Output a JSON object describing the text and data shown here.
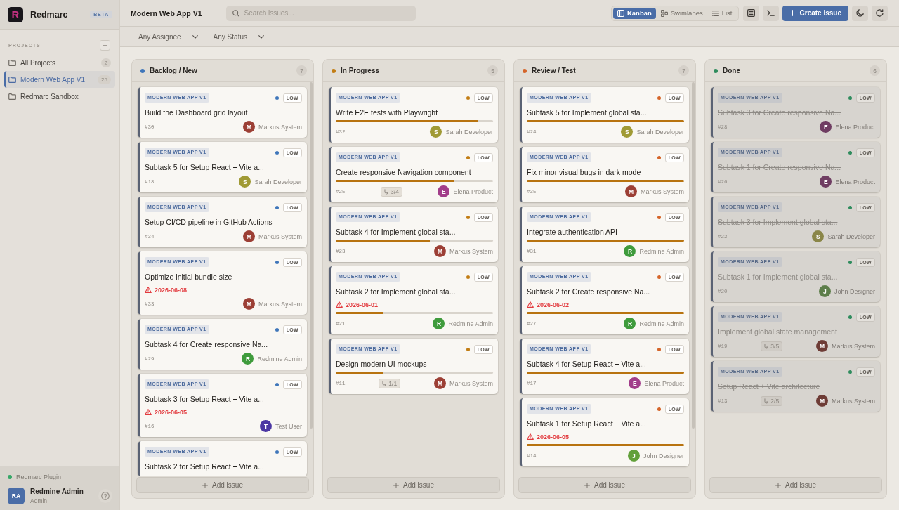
{
  "sidebar": {
    "brand": {
      "logo": "R",
      "name": "Redmarc",
      "badge": "BETA"
    },
    "section_label": "PROJECTS",
    "projects": [
      {
        "label": "All Projects",
        "count": "2",
        "selected": false
      },
      {
        "label": "Modern Web App V1",
        "count": "25",
        "selected": true
      },
      {
        "label": "Redmarc Sandbox",
        "selected": false
      }
    ],
    "plugin": {
      "label": "Redmarc Plugin",
      "active": true
    },
    "user": {
      "initials": "RA",
      "name": "Redmine Admin",
      "role": "Admin"
    }
  },
  "topbar": {
    "title": "Modern Web App V1",
    "search": {
      "placeholder": "Search issues..."
    },
    "views": [
      {
        "kind": "kanban",
        "label": "Kanban",
        "selected": true
      },
      {
        "kind": "swimlanes",
        "label": "Swimlanes",
        "selected": false
      },
      {
        "kind": "list",
        "label": "List",
        "selected": false
      }
    ],
    "create_button": "Create issue"
  },
  "filters": [
    {
      "value": "Any Assignee"
    },
    {
      "value": "Any Status"
    }
  ],
  "columns": [
    {
      "title": "Backlog / New",
      "count": "7",
      "color": "#3f76ba",
      "scrollable": true,
      "add_label": "Add issue",
      "cards": [
        {
          "project": "MODERN WEB APP V1",
          "priority": "LOW",
          "title": "Build the Dashboard grid layout",
          "number": "#30",
          "assignee": {
            "initial": "M",
            "name": "Markus System",
            "color": "#9c3f35"
          },
          "closed": false
        },
        {
          "project": "MODERN WEB APP V1",
          "priority": "LOW",
          "title": "Subtask 5 for Setup React + Vite a...",
          "number": "#18",
          "assignee": {
            "initial": "S",
            "name": "Sarah Developer",
            "color": "#a09a35"
          },
          "closed": false
        },
        {
          "project": "MODERN WEB APP V1",
          "priority": "LOW",
          "title": "Setup CI/CD pipeline in GitHub Actions",
          "number": "#34",
          "assignee": {
            "initial": "M",
            "name": "Markus System",
            "color": "#9c3f35"
          },
          "closed": false
        },
        {
          "project": "MODERN WEB APP V1",
          "priority": "LOW",
          "title": "Optimize initial bundle size",
          "due": "2026-06-08",
          "overdue": true,
          "number": "#33",
          "assignee": {
            "initial": "M",
            "name": "Markus System",
            "color": "#9c3f35"
          },
          "closed": false
        },
        {
          "project": "MODERN WEB APP V1",
          "priority": "LOW",
          "title": "Subtask 4 for Create responsive Na...",
          "number": "#29",
          "assignee": {
            "initial": "R",
            "name": "Redmine Admin",
            "color": "#3f9b3c"
          },
          "closed": false
        },
        {
          "project": "MODERN WEB APP V1",
          "priority": "LOW",
          "title": "Subtask 3 for Setup React + Vite a...",
          "due": "2026-06-05",
          "overdue": true,
          "number": "#16",
          "assignee": {
            "initial": "T",
            "name": "Test User",
            "color": "#4b37a3"
          },
          "closed": false
        },
        {
          "project": "MODERN WEB APP V1",
          "priority": "LOW",
          "title": "Subtask 2 for Setup React + Vite a...",
          "closed": false
        }
      ]
    },
    {
      "title": "In Progress",
      "count": "5",
      "color": "#c27d14",
      "scrollable": false,
      "add_label": "Add issue",
      "cards": [
        {
          "project": "MODERN WEB APP V1",
          "priority": "LOW",
          "title": "Write E2E tests with Playwright",
          "level": 0.9,
          "number": "#32",
          "assignee": {
            "initial": "S",
            "name": "Sarah Developer",
            "color": "#a09a35"
          },
          "closed": false
        },
        {
          "project": "MODERN WEB APP V1",
          "priority": "LOW",
          "title": "Create responsive Navigation component",
          "level": 0.75,
          "number": "#25",
          "subtasks": "3/4",
          "assignee": {
            "initial": "E",
            "name": "Elena Product",
            "color": "#a23d8a"
          },
          "closed": false
        },
        {
          "project": "MODERN WEB APP V1",
          "priority": "LOW",
          "title": "Subtask 4 for Implement global sta...",
          "level": 0.6,
          "number": "#23",
          "assignee": {
            "initial": "M",
            "name": "Markus System",
            "color": "#9c3f35"
          },
          "closed": false
        },
        {
          "project": "MODERN WEB APP V1",
          "priority": "LOW",
          "title": "Subtask 2 for Implement global sta...",
          "due": "2026-06-01",
          "overdue": true,
          "level": 0.3,
          "number": "#21",
          "assignee": {
            "initial": "R",
            "name": "Redmine Admin",
            "color": "#3f9b3c"
          },
          "closed": false
        },
        {
          "project": "MODERN WEB APP V1",
          "priority": "LOW",
          "title": "Design modern UI mockups",
          "level": 0.3,
          "number": "#11",
          "subtasks": "1/1",
          "assignee": {
            "initial": "M",
            "name": "Markus System",
            "color": "#9c3f35"
          },
          "closed": false
        }
      ]
    },
    {
      "title": "Review / Test",
      "count": "7",
      "color": "#d5652a",
      "scrollable": true,
      "add_label": "Add issue",
      "cards": [
        {
          "project": "MODERN WEB APP V1",
          "priority": "LOW",
          "title": "Subtask 5 for Implement global sta...",
          "level": 1,
          "number": "#24",
          "assignee": {
            "initial": "S",
            "name": "Sarah Developer",
            "color": "#a09a35"
          },
          "closed": false
        },
        {
          "project": "MODERN WEB APP V1",
          "priority": "LOW",
          "title": "Fix minor visual bugs in dark mode",
          "level": 1,
          "number": "#35",
          "assignee": {
            "initial": "M",
            "name": "Markus System",
            "color": "#9c3f35"
          },
          "closed": false
        },
        {
          "project": "MODERN WEB APP V1",
          "priority": "LOW",
          "title": "Integrate authentication API",
          "level": 1,
          "number": "#31",
          "assignee": {
            "initial": "R",
            "name": "Redmine Admin",
            "color": "#3f9b3c"
          },
          "closed": false
        },
        {
          "project": "MODERN WEB APP V1",
          "priority": "LOW",
          "title": "Subtask 2 for Create responsive Na...",
          "due": "2026-06-02",
          "overdue": true,
          "level": 1,
          "number": "#27",
          "assignee": {
            "initial": "R",
            "name": "Redmine Admin",
            "color": "#3f9b3c"
          },
          "closed": false
        },
        {
          "project": "MODERN WEB APP V1",
          "priority": "LOW",
          "title": "Subtask 4 for Setup React + Vite a...",
          "level": 1,
          "number": "#17",
          "assignee": {
            "initial": "E",
            "name": "Elena Product",
            "color": "#a23d8a"
          },
          "closed": false
        },
        {
          "project": "MODERN WEB APP V1",
          "priority": "LOW",
          "title": "Subtask 1 for Setup React + Vite a...",
          "due": "2026-06-05",
          "overdue": true,
          "level": 1,
          "number": "#14",
          "assignee": {
            "initial": "J",
            "name": "John Designer",
            "color": "#62a03a"
          },
          "closed": false
        }
      ]
    },
    {
      "title": "Done",
      "count": "6",
      "color": "#2f8c5d",
      "scrollable": false,
      "add_label": "Add issue",
      "cards": [
        {
          "project": "MODERN WEB APP V1",
          "priority": "LOW",
          "title": "Subtask 3 for Create responsive Na...",
          "number": "#28",
          "assignee": {
            "initial": "E",
            "name": "Elena Product",
            "color": "#6f3d62"
          },
          "closed": true
        },
        {
          "project": "MODERN WEB APP V1",
          "priority": "LOW",
          "title": "Subtask 1 for Create responsive Na...",
          "number": "#26",
          "assignee": {
            "initial": "E",
            "name": "Elena Product",
            "color": "#6f3d62"
          },
          "closed": true
        },
        {
          "project": "MODERN WEB APP V1",
          "priority": "LOW",
          "title": "Subtask 3 for Implement global sta...",
          "number": "#22",
          "assignee": {
            "initial": "S",
            "name": "Sarah Developer",
            "color": "#8a8648"
          },
          "closed": true
        },
        {
          "project": "MODERN WEB APP V1",
          "priority": "LOW",
          "title": "Subtask 1 for Implement global sta...",
          "number": "#20",
          "assignee": {
            "initial": "J",
            "name": "John Designer",
            "color": "#5d7e4a"
          },
          "closed": true
        },
        {
          "project": "MODERN WEB APP V1",
          "priority": "LOW",
          "title": "Implement global state management",
          "number": "#19",
          "subtasks": "3/5",
          "assignee": {
            "initial": "M",
            "name": "Markus System",
            "color": "#6e3c36"
          },
          "closed": true
        },
        {
          "project": "MODERN WEB APP V1",
          "priority": "LOW",
          "title": "Setup React + Vite architecture",
          "number": "#13",
          "subtasks": "2/5",
          "assignee": {
            "initial": "M",
            "name": "Markus System",
            "color": "#6e3c36"
          },
          "closed": true
        }
      ]
    }
  ]
}
